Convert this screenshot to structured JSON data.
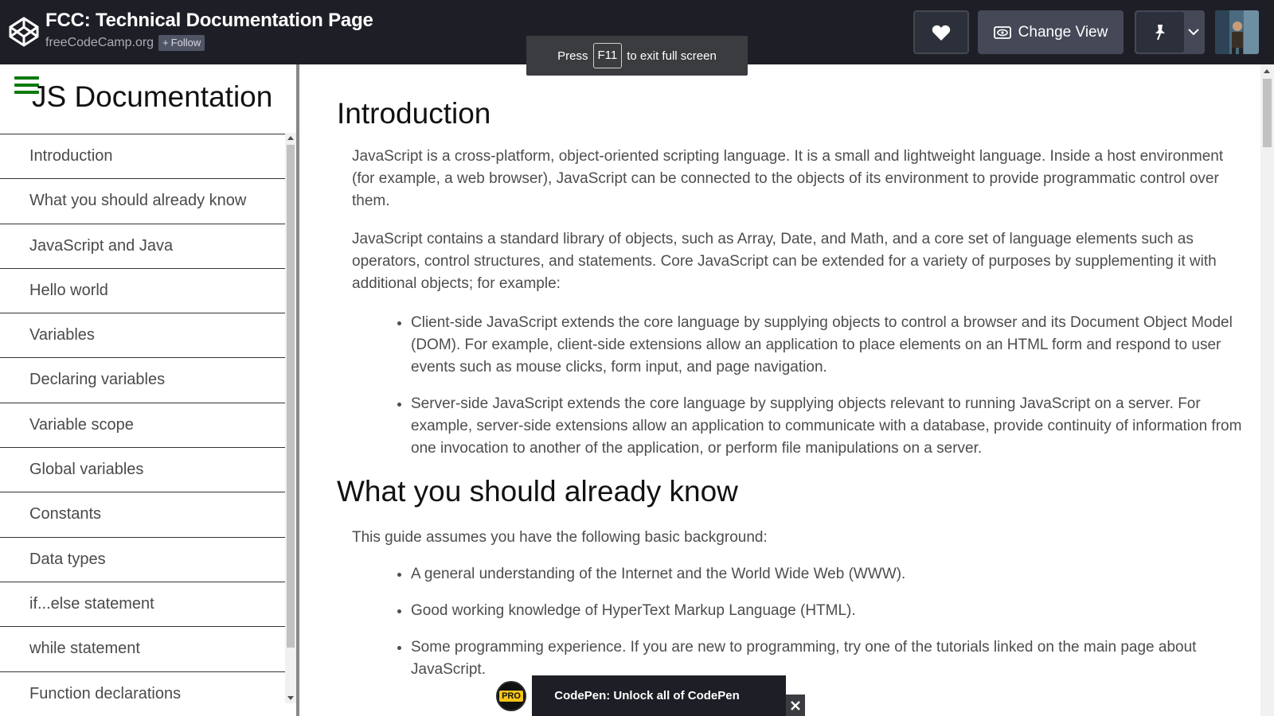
{
  "header": {
    "title": "FCC: Technical Documentation Page",
    "author": "freeCodeCamp.org",
    "follow_label": "Follow",
    "change_view_label": "Change View",
    "icons": [
      "codepen-logo-icon",
      "heart-icon",
      "eye-icon",
      "pin-icon",
      "chevron-down-icon"
    ]
  },
  "fullscreen_toast": {
    "press": "Press",
    "key": "F11",
    "message": "to exit full screen"
  },
  "sidebar": {
    "title": "JS Documentation",
    "menu_icon": "hamburger-icon",
    "menu_icon_color": "#0a7a0a",
    "items": [
      "Introduction",
      "What you should already know",
      "JavaScript and Java",
      "Hello world",
      "Variables",
      "Declaring variables",
      "Variable scope",
      "Global variables",
      "Constants",
      "Data types",
      "if...else statement",
      "while statement",
      "Function declarations"
    ]
  },
  "main": {
    "sections": [
      {
        "title": "Introduction",
        "paragraphs": [
          "JavaScript is a cross-platform, object-oriented scripting language. It is a small and lightweight language. Inside a host environment (for example, a web browser), JavaScript can be connected to the objects of its environment to provide programmatic control over them.",
          "JavaScript contains a standard library of objects, such as Array, Date, and Math, and a core set of language elements such as operators, control structures, and statements. Core JavaScript can be extended for a variety of purposes by supplementing it with additional objects; for example:"
        ],
        "bullets": [
          "Client-side JavaScript extends the core language by supplying objects to control a browser and its Document Object Model (DOM). For example, client-side extensions allow an application to place elements on an HTML form and respond to user events such as mouse clicks, form input, and page navigation.",
          "Server-side JavaScript extends the core language by supplying objects relevant to running JavaScript on a server. For example, server-side extensions allow an application to communicate with a database, provide continuity of information from one invocation to another of the application, or perform file manipulations on a server."
        ]
      },
      {
        "title": "What you should already know",
        "paragraphs": [
          "This guide assumes you have the following basic background:"
        ],
        "bullets": [
          "A general understanding of the Internet and the World Wide Web (WWW).",
          "Good working knowledge of HyperText Markup Language (HTML).",
          "Some programming experience. If you are new to programming, try one of the tutorials linked on the main page about JavaScript."
        ]
      }
    ]
  },
  "pro_banner": {
    "badge": "PRO",
    "text": "CodePen: Unlock all of CodePen",
    "close_icon": "close-icon"
  },
  "colors": {
    "header_bg": "#1e1f26",
    "button_bg": "#444857",
    "badge_yellow": "#f5c518"
  }
}
